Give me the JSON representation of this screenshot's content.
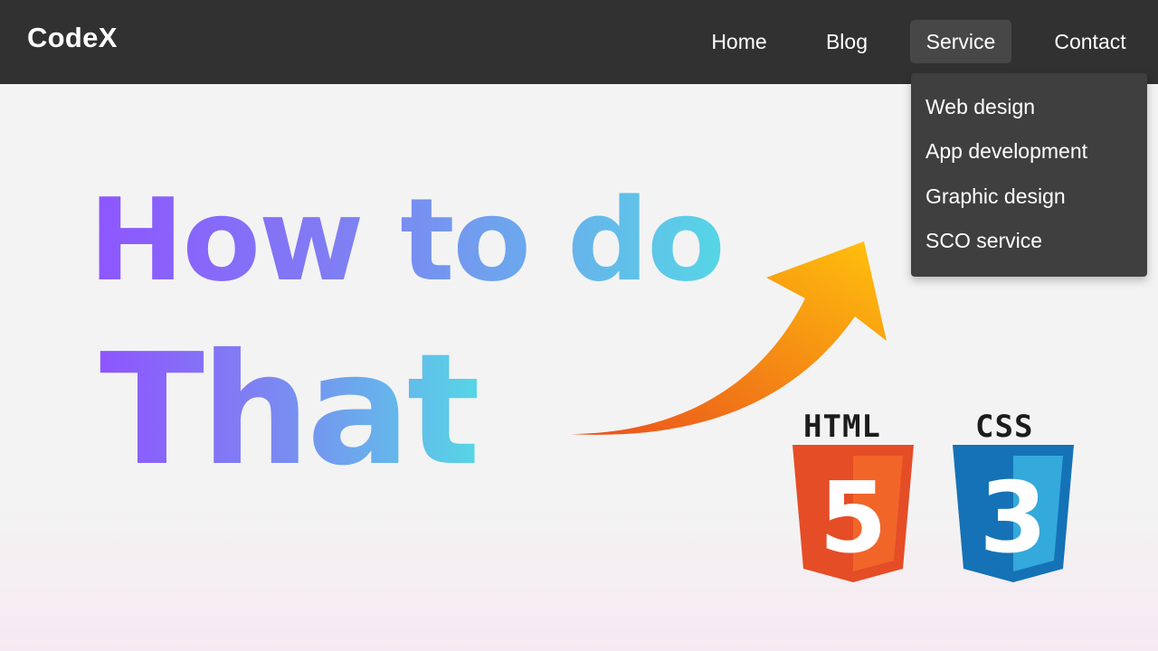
{
  "navbar": {
    "brand": "CodeX",
    "items": [
      {
        "label": "Home"
      },
      {
        "label": "Blog"
      },
      {
        "label": "Service",
        "active": true
      },
      {
        "label": "Contact"
      }
    ],
    "dropdown": [
      {
        "label": "Web design"
      },
      {
        "label": "App development"
      },
      {
        "label": "Graphic design"
      },
      {
        "label": "SCO service"
      }
    ]
  },
  "hero": {
    "line1": "How to do",
    "line2": "That"
  },
  "logos": {
    "html_label": "HTML",
    "html_number": "5",
    "css_label": "CSS",
    "css_number": "3"
  },
  "colors": {
    "navbar_bg": "#313131",
    "dropdown_bg": "#3f3f3f",
    "gradient_start": "#8e55ff",
    "gradient_end": "#56d6e6",
    "arrow_start": "#ea4f1d",
    "arrow_end": "#ffc20c",
    "html_orange": "#e44d26",
    "css_blue": "#1572b6"
  },
  "icons": [
    "curved-arrow-icon",
    "html5-logo-icon",
    "css3-logo-icon"
  ]
}
